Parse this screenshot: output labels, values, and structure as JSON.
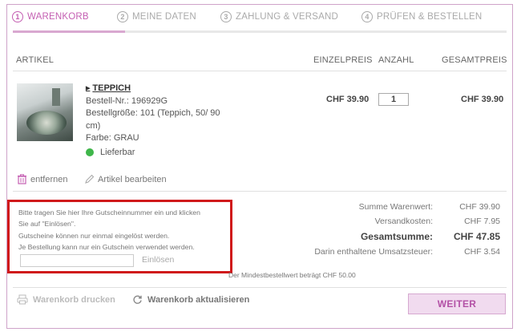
{
  "steps": [
    {
      "num": "1",
      "label": "WARENKORB"
    },
    {
      "num": "2",
      "label": "MEINE DATEN"
    },
    {
      "num": "3",
      "label": "ZAHLUNG & VERSAND"
    },
    {
      "num": "4",
      "label": "PRÜFEN & BESTELLEN"
    }
  ],
  "table": {
    "col_artikel": "ARTIKEL",
    "col_einzelpreis": "EINZELPREIS",
    "col_anzahl": "ANZAHL",
    "col_gesamtpreis": "GESAMTPREIS"
  },
  "item": {
    "name": "TEPPICH",
    "order_no": "Bestell-Nr.: 196929G",
    "size_line1": "Bestellgröße: 101 (Teppich, 50/ 90",
    "size_line2": "cm)",
    "color": "Farbe: GRAU",
    "availability": "Lieferbar",
    "unit_price": "CHF 39.90",
    "quantity": "1",
    "total_price": "CHF 39.90",
    "remove_label": "entfernen",
    "edit_label": "Artikel bearbeiten"
  },
  "coupon": {
    "line1": "Bitte tragen Sie hier Ihre Gutscheinnummer ein und klicken",
    "line2": "Sie auf \"Einlösen\".",
    "line3": "Gutscheine können nur einmal eingelöst werden.",
    "line4": "Je Bestellung kann nur ein Gutschein verwendet werden.",
    "input_value": "",
    "redeem_label": "Einlösen"
  },
  "summary": {
    "subtotal_label": "Summe Warenwert:",
    "subtotal_value": "CHF 39.90",
    "shipping_label": "Versandkosten:",
    "shipping_value": "CHF 7.95",
    "total_label": "Gesamtsumme:",
    "total_value": "CHF 47.85",
    "vat_label": "Darin enthaltene Umsatzsteuer:",
    "vat_value": "CHF 3.54"
  },
  "min_order_note": "Der Mindestbestellwert beträgt CHF 50.00",
  "footer": {
    "print_label": "Warenkorb drucken",
    "update_label": "Warenkorb aktualisieren",
    "next_label": "WEITER"
  },
  "colors": {
    "accent": "#c45fb2",
    "available": "#3fb64a",
    "highlight_box": "#d0191b"
  }
}
